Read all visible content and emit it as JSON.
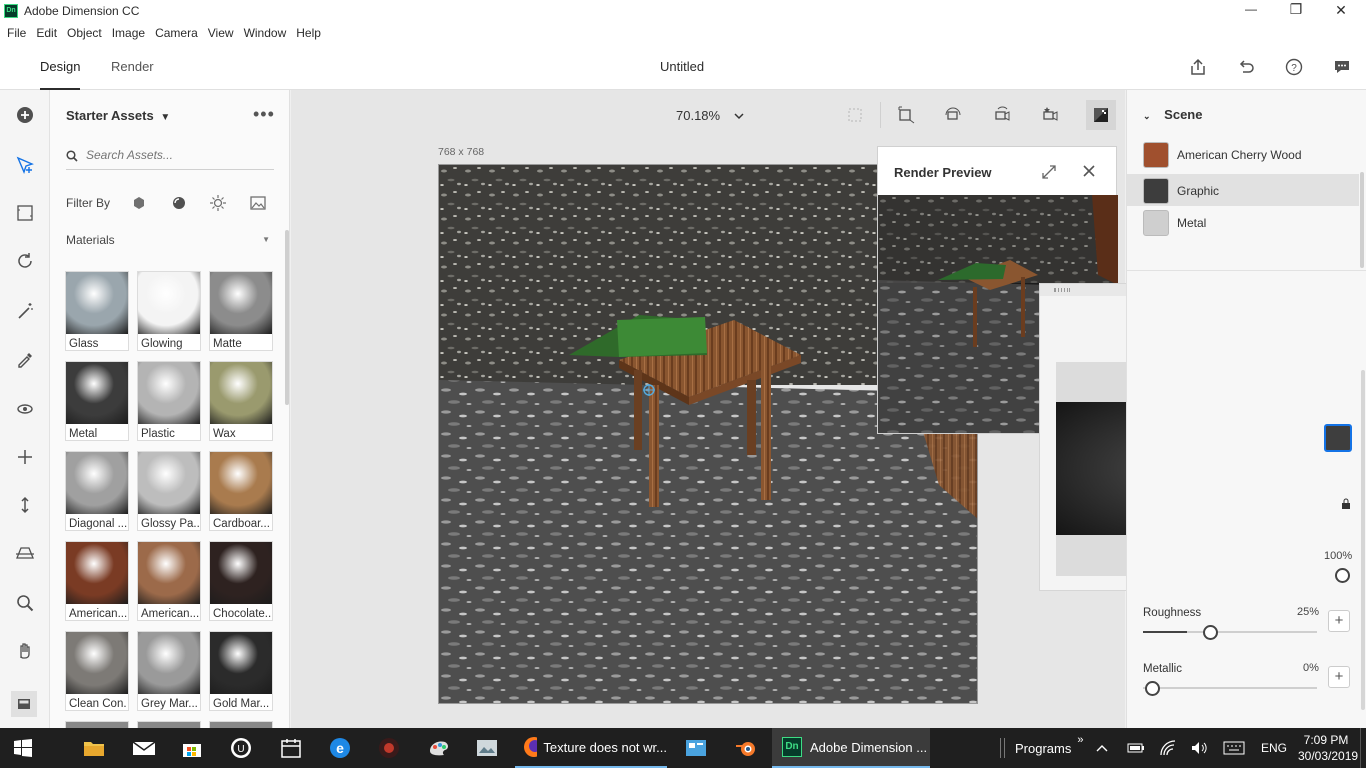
{
  "window": {
    "app_badge": "Dn",
    "title": "Adobe Dimension CC",
    "min": "—",
    "max": "❐",
    "close": "✕"
  },
  "menu": [
    "File",
    "Edit",
    "Object",
    "Image",
    "Camera",
    "View",
    "Window",
    "Help"
  ],
  "header": {
    "tabs": [
      "Design",
      "Render"
    ],
    "active_tab": "Design",
    "document_title": "Untitled"
  },
  "assets": {
    "title": "Starter Assets",
    "search_placeholder": "Search Assets...",
    "filter_label": "Filter By",
    "section": "Materials",
    "items": [
      {
        "label": "Glass",
        "color": "#9aa6ad"
      },
      {
        "label": "Glowing",
        "color": "#f4f4f4"
      },
      {
        "label": "Matte",
        "color": "#8c8c8c"
      },
      {
        "label": "Metal",
        "color": "#3c3c3c"
      },
      {
        "label": "Plastic",
        "color": "#b4b4b4"
      },
      {
        "label": "Wax",
        "color": "#9a9a6e"
      },
      {
        "label": "Diagonal ...",
        "color": "#a0a0a0"
      },
      {
        "label": "Glossy Pa...",
        "color": "#bdbdbd"
      },
      {
        "label": "Cardboar...",
        "color": "#a97b4e"
      },
      {
        "label": "American...",
        "color": "#7a3b24"
      },
      {
        "label": "American...",
        "color": "#9c6a4a"
      },
      {
        "label": "Chocolate...",
        "color": "#2e2220"
      },
      {
        "label": "Clean Con...",
        "color": "#7d7a76"
      },
      {
        "label": "Grey Mar...",
        "color": "#9a9a9a"
      },
      {
        "label": "Gold Mar...",
        "color": "#2b2b2b"
      }
    ]
  },
  "canvas": {
    "zoom": "70.18%",
    "size_label": "768 x 768"
  },
  "render_preview": {
    "title": "Render Preview"
  },
  "scene": {
    "title": "Scene",
    "items": [
      {
        "label": "American Cherry Wood",
        "color": "#a0502e",
        "selected": false
      },
      {
        "label": "Graphic",
        "color": "#3d3d3d",
        "selected": true
      },
      {
        "label": "Metal",
        "color": "#cfcfcf",
        "selected": false
      }
    ]
  },
  "properties": {
    "opacity_value": "100%",
    "opacity_level": 1.0,
    "roughness_label": "Roughness",
    "roughness_value": "25%",
    "roughness_level": 0.25,
    "metallic_label": "Metallic",
    "metallic_value": "0%",
    "metallic_level": 0.0
  },
  "taskbar": {
    "firefox_label": "Texture does not wr...",
    "dimension_badge": "Dn",
    "dimension_label": "Adobe Dimension ...",
    "programs": "Programs",
    "language": "ENG",
    "time": "7:09 PM",
    "date": "30/03/2019"
  }
}
